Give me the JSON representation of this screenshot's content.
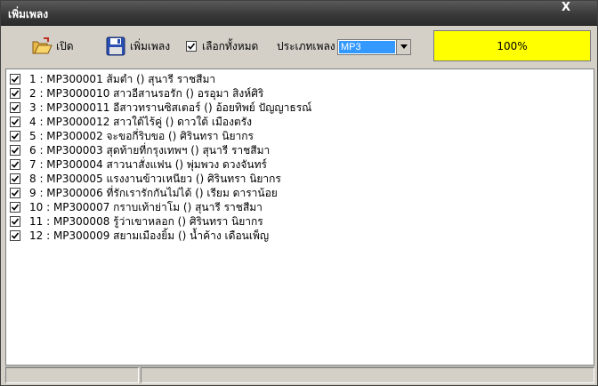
{
  "window": {
    "title": "เพิ่มเพลง",
    "close_label": "X"
  },
  "toolbar": {
    "open_label": "เปิด",
    "add_song_label": "เพิ่มเพลง",
    "select_all_label": "เลือกทั้งหมด",
    "select_all_checked": true,
    "song_type_label": "ประเภทเพลง",
    "song_type_value": "MP3"
  },
  "progress": {
    "text": "100%",
    "value": 1.0
  },
  "songs": [
    {
      "checked": true,
      "text": "1 : MP300001 ส้มตำ () สุนารี ราชสีมา"
    },
    {
      "checked": true,
      "text": "2 : MP3000010 สาวอีสานรอรัก () อรอุมา สิงห์ศิริ"
    },
    {
      "checked": true,
      "text": "3 : MP3000011 อีสาวทรานซิสเตอร์ () อ้อยทิพย์ ปัญญาธรณ์"
    },
    {
      "checked": true,
      "text": "4 : MP3000012 สาวใต้ไร้คู่ () ดาวใต้ เมืองตรัง"
    },
    {
      "checked": true,
      "text": "5 : MP300002 จะขอกี่ริบขอ () ศิรินทรา นิยากร"
    },
    {
      "checked": true,
      "text": "6 : MP300003 สุดท้ายที่กรุงเทพฯ () สุนารี ราชสีมา"
    },
    {
      "checked": true,
      "text": "7 : MP300004 สาวนาสั่งแฟน () พุ่มพวง ดวงจันทร์"
    },
    {
      "checked": true,
      "text": "8 : MP300005 แรงงานข้าวเหนียว () ศิรินทรา นิยากร"
    },
    {
      "checked": true,
      "text": "9 : MP300006 ที่รักเรารักกันไม่ได้ () เรียม ดาราน้อย"
    },
    {
      "checked": true,
      "text": "10 : MP300007 กราบเท้าย่าโม () สุนารี ราชสีมา"
    },
    {
      "checked": true,
      "text": "11 : MP300008 รู้ว่าเขาหลอก () ศิรินทรา นิยากร"
    },
    {
      "checked": true,
      "text": "12 : MP300009 สยามเมืองยิ้ม () น้ำค้าง เดือนเพ็ญ"
    }
  ]
}
